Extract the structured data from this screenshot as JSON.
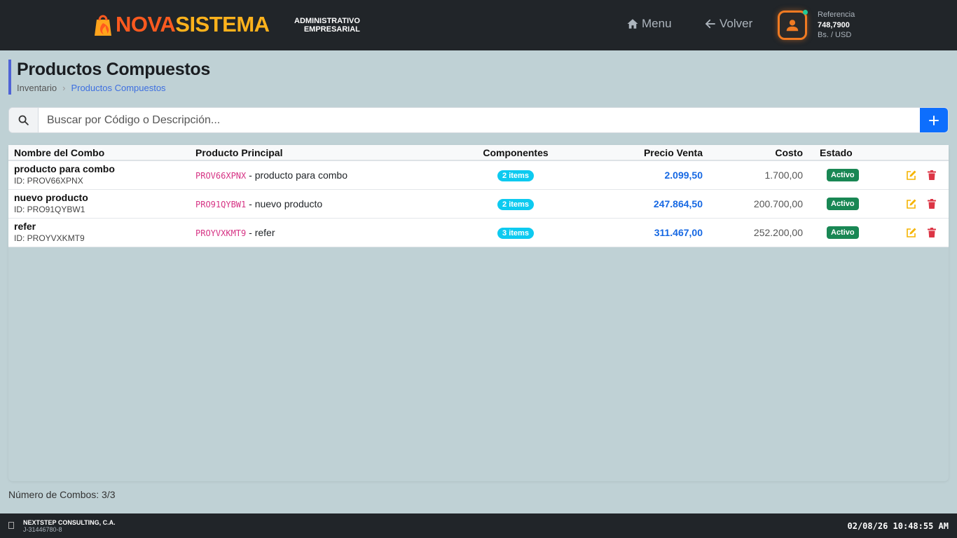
{
  "header": {
    "logo_part1": "NOVA",
    "logo_part2": "SISTEMA",
    "subtitle_line1": "ADMINISTRATIVO",
    "subtitle_line2": "EMPRESARIAL",
    "menu_label": "Menu",
    "back_label": "Volver",
    "reference_label": "Referencia",
    "reference_value": "748,7900",
    "reference_unit": "Bs. / USD"
  },
  "page": {
    "title": "Productos Compuestos",
    "breadcrumb": [
      "Inventario",
      "Productos Compuestos"
    ]
  },
  "search": {
    "placeholder": "Buscar por Código o Descripción...",
    "value": ""
  },
  "table": {
    "columns": [
      "Nombre del Combo",
      "Producto Principal",
      "Componentes",
      "Precio Venta",
      "Costo",
      "Estado"
    ],
    "rows": [
      {
        "name": "producto para combo",
        "id": "ID: PROV66XPNX",
        "code": "PROV66XPNX",
        "main": " - producto para combo",
        "components": "2 items",
        "price": "2.099,50",
        "cost": "1.700,00",
        "status": "Activo"
      },
      {
        "name": "nuevo producto",
        "id": "ID: PRO91QYBW1",
        "code": "PRO91QYBW1",
        "main": " - nuevo producto",
        "components": "2 items",
        "price": "247.864,50",
        "cost": "200.700,00",
        "status": "Activo"
      },
      {
        "name": "refer",
        "id": "ID: PROYVXKMT9",
        "code": "PROYVXKMT9",
        "main": " - refer",
        "components": "3 items",
        "price": "311.467,00",
        "cost": "252.200,00",
        "status": "Activo"
      }
    ]
  },
  "count_text": "Número de Combos: 3/3",
  "footer": {
    "company": "NEXTSTEP CONSULTING, C.A.",
    "rif": "J-31446780-8",
    "datetime": "02/08/26 10:48:55 AM"
  },
  "colors": {
    "topbar": "#212529",
    "accent": "#0d6efd",
    "price": "#1668e3",
    "status_active": "#198754",
    "items_badge": "#0dcaf0",
    "edit": "#f5b400",
    "delete": "#dc3545"
  }
}
